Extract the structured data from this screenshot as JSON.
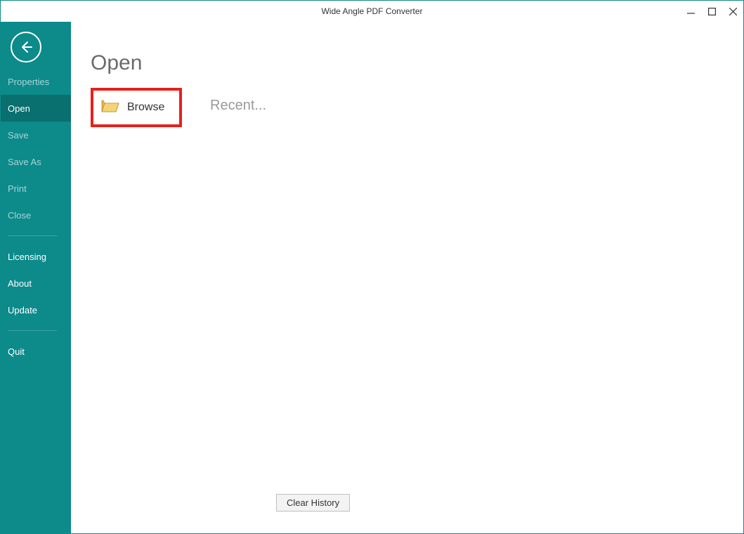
{
  "window": {
    "title": "Wide Angle PDF Converter"
  },
  "sidebar": {
    "items": {
      "properties": "Properties",
      "open": "Open",
      "save": "Save",
      "save_as": "Save As",
      "print": "Print",
      "close": "Close",
      "licensing": "Licensing",
      "about": "About",
      "update": "Update",
      "quit": "Quit"
    }
  },
  "main": {
    "title": "Open",
    "browse_label": "Browse",
    "recent_label": "Recent...",
    "clear_history_label": "Clear History"
  }
}
